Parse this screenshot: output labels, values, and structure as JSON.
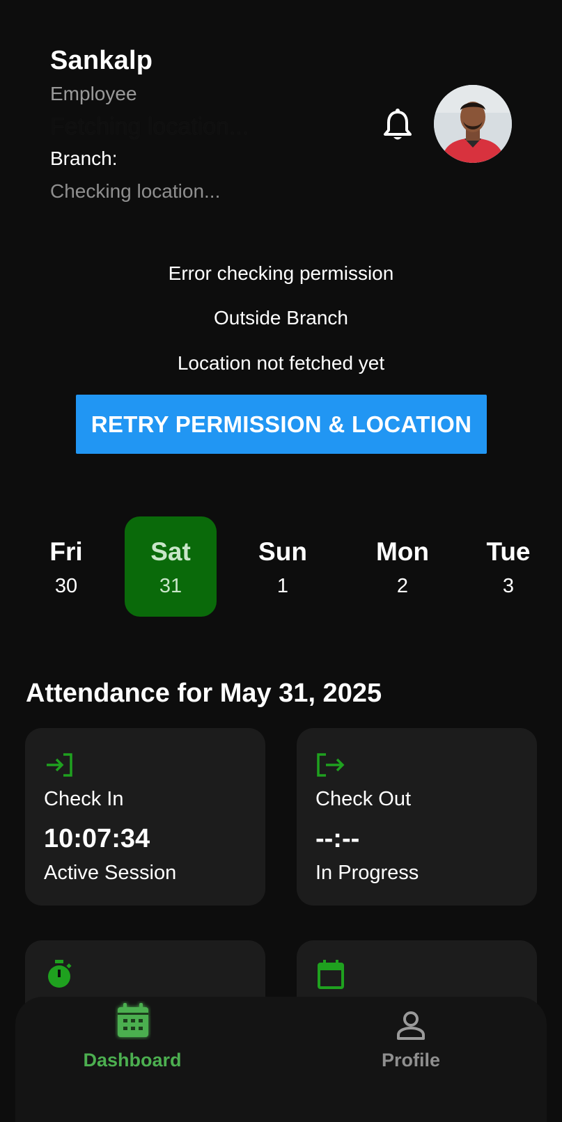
{
  "header": {
    "name": "Sankalp",
    "role": "Employee",
    "location_status": "Fetching location...",
    "branch_label": "Branch:",
    "branch_status": "Checking location..."
  },
  "status": {
    "permission_message": "Error checking permission",
    "branch_message": "Outside Branch",
    "location_message": "Location not fetched yet",
    "retry_label": "RETRY PERMISSION & LOCATION"
  },
  "days": [
    {
      "name": "Fri",
      "num": "30"
    },
    {
      "name": "Sat",
      "num": "31"
    },
    {
      "name": "Sun",
      "num": "1"
    },
    {
      "name": "Mon",
      "num": "2"
    },
    {
      "name": "Tue",
      "num": "3"
    }
  ],
  "attendance": {
    "title": "Attendance for May 31, 2025",
    "check_in": {
      "label": "Check In",
      "time": "10:07:34",
      "status": "Active Session"
    },
    "check_out": {
      "label": "Check Out",
      "time": "--:--",
      "status": "In Progress"
    }
  },
  "nav": {
    "dashboard": "Dashboard",
    "profile": "Profile"
  },
  "colors": {
    "accent_blue": "#2196f3",
    "selected_green": "#0a6a0a",
    "icon_green": "#1fa11f",
    "nav_active": "#4caf50",
    "card_bg": "#1c1c1c"
  }
}
